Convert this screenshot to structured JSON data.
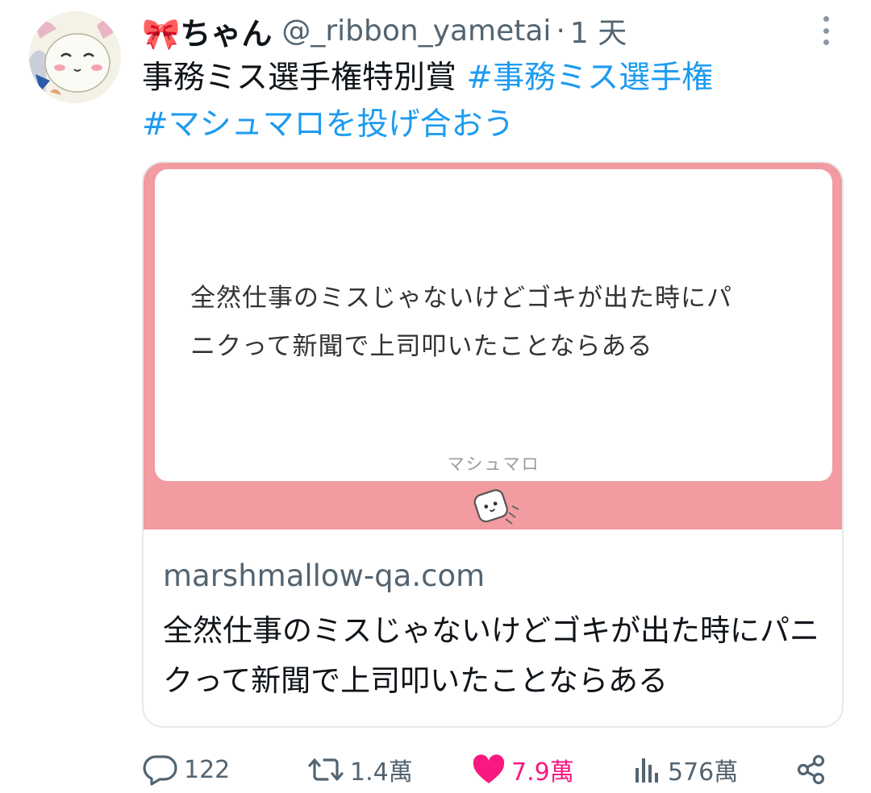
{
  "tweet": {
    "display_name": "🎀ちゃん",
    "handle": "@_ribbon_yametai",
    "separator": "·",
    "time": "1 天",
    "text_plain": "事務ミス選手権特別賞 ",
    "hashtag_1": "#事務ミス選手権",
    "hashtag_2": "#マシュマロを投げ合おう"
  },
  "card": {
    "question_line_1": "全然仕事のミスじゃないけどゴキが出た時にパ",
    "question_line_2": "ニクって新聞で上司叩いたことならある",
    "service_label": "マシュマロ",
    "domain": "marshmallow-qa.com",
    "description": "全然仕事のミスじゃないけどゴキが出た時にパニクって新聞で上司叩いたことならある"
  },
  "actions": {
    "replies": "122",
    "retweets": "1.4萬",
    "likes": "7.9萬",
    "views": "576萬"
  },
  "colors": {
    "hashtag": "#1d9bf0",
    "like": "#f91880",
    "card_image_bg": "#f29ba0",
    "secondary_text": "#536471"
  },
  "icons": {
    "reply": "reply-icon",
    "retweet": "retweet-icon",
    "like": "heart-icon",
    "views": "views-chart-icon",
    "share": "share-icon",
    "more": "more-vertical-icon"
  }
}
